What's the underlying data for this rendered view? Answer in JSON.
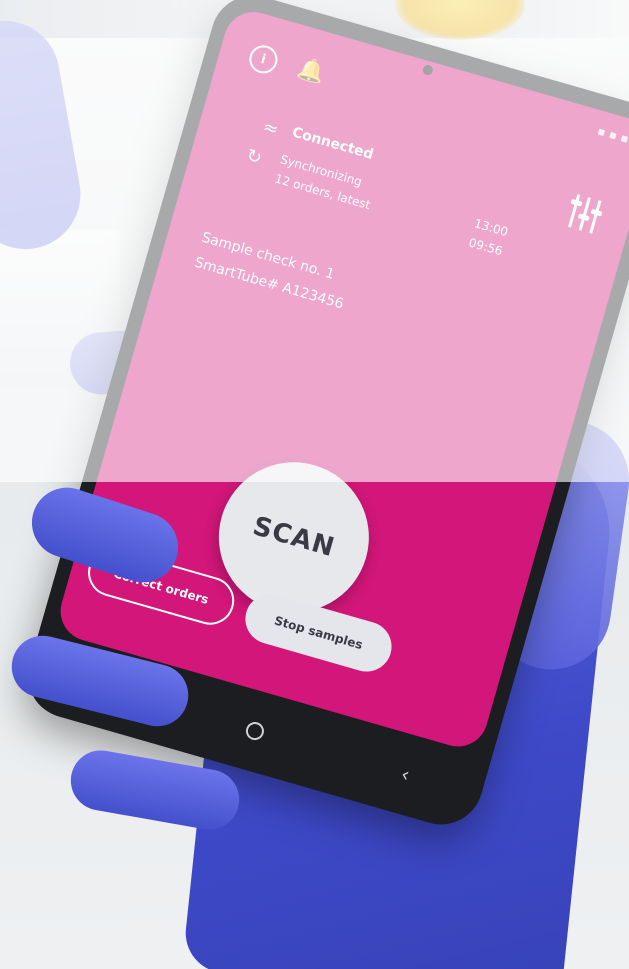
{
  "screen": {
    "connection_label": "Connected",
    "sync_label": "Synchronizing",
    "sync_time": "13:00",
    "orders_label": "12 orders, latest",
    "orders_time": "09:56",
    "sample_check": "Sample check no. 1",
    "smarttube": "SmartTube# A123456"
  },
  "buttons": {
    "scan": "SCAN",
    "correct_orders": "Correct orders",
    "stop_samples": "Stop samples"
  },
  "colors": {
    "screen": "#d2167a",
    "glove": "#4a55d6",
    "bell": "#f2c230"
  },
  "icons": [
    "info-icon",
    "bell-icon",
    "sliders-icon",
    "wifi-icon",
    "sync-icon",
    "recent-apps-icon",
    "home-icon",
    "back-icon"
  ]
}
